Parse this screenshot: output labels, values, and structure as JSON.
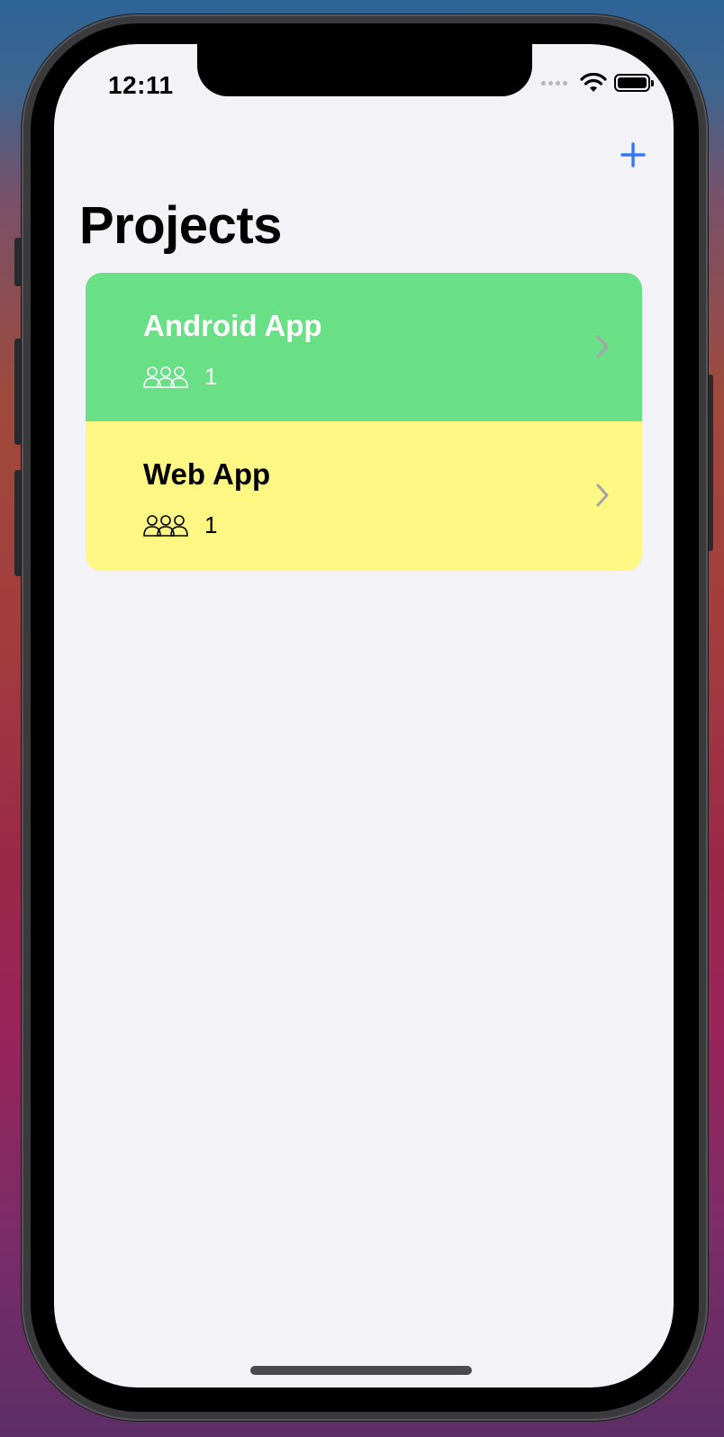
{
  "status_bar": {
    "time": "12:11"
  },
  "nav": {
    "add_icon": "plus-icon",
    "title": "Projects"
  },
  "projects": [
    {
      "name": "Android App",
      "member_count": "1",
      "background": "#69df86",
      "text_color": "#ffffff",
      "icon": "people-icon"
    },
    {
      "name": "Web App",
      "member_count": "1",
      "background": "#fef784",
      "text_color": "#000000",
      "icon": "people-icon"
    }
  ],
  "colors": {
    "accent": "#3478f6",
    "background": "#f2f2f7",
    "chevron": "#a5a5a8"
  }
}
